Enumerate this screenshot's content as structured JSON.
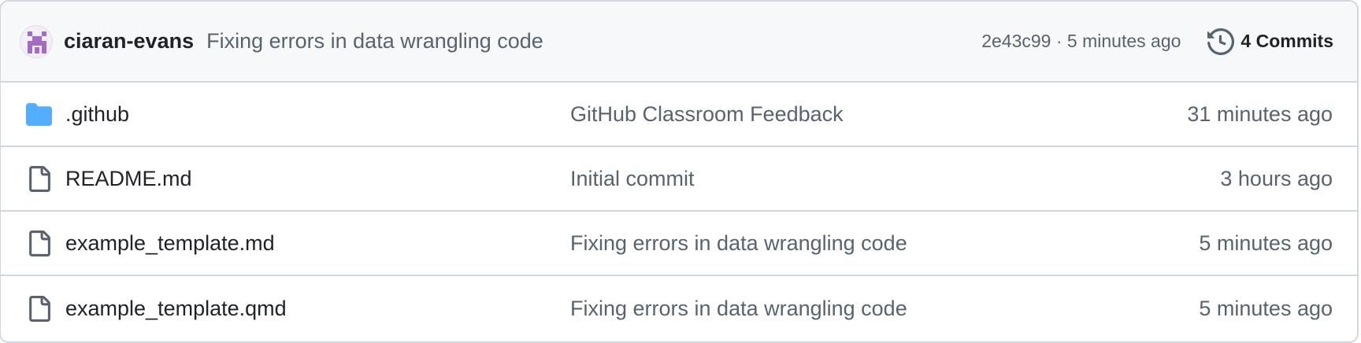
{
  "latest_commit": {
    "author": "ciaran-evans",
    "message": "Fixing errors in data wrangling code",
    "hash": "2e43c99",
    "separator": " · ",
    "time": "5 minutes ago",
    "commits_label": "4 Commits",
    "avatar_color": "#a36ac7"
  },
  "files": [
    {
      "type": "folder",
      "icon": "folder-icon",
      "name": ".github",
      "message": "GitHub Classroom Feedback",
      "time": "31 minutes ago"
    },
    {
      "type": "file",
      "icon": "file-icon",
      "name": "README.md",
      "message": "Initial commit",
      "time": "3 hours ago"
    },
    {
      "type": "file",
      "icon": "file-icon",
      "name": "example_template.md",
      "message": "Fixing errors in data wrangling code",
      "time": "5 minutes ago"
    },
    {
      "type": "file",
      "icon": "file-icon",
      "name": "example_template.qmd",
      "message": "Fixing errors in data wrangling code",
      "time": "5 minutes ago"
    }
  ],
  "colors": {
    "folder": "#54aeff",
    "muted_text": "#59636e",
    "border": "#d0d7de",
    "header_bg": "#f6f8fa"
  }
}
